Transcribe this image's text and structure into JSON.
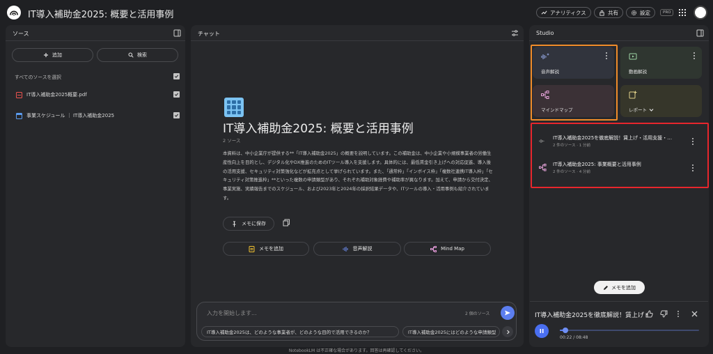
{
  "app": {
    "notebook_title": "IT導入補助金2025: 概要と活用事例",
    "footer": "NotebookLM は不正確な場合があります。回答は再確認してください。"
  },
  "header": {
    "analytics": "アナリティクス",
    "share": "共有",
    "settings": "設定",
    "pro_badge": "PRO"
  },
  "sources": {
    "heading": "ソース",
    "add": "追加",
    "search": "検索",
    "select_all": "すべてのソースを選択",
    "items": [
      {
        "label": "IT導入補助金2025概要.pdf",
        "type": "pdf"
      },
      {
        "label": "事業スケジュール ｜ IT導入補助金2025",
        "type": "web"
      }
    ]
  },
  "chat": {
    "heading": "チャット",
    "title": "IT導入補助金2025: 概要と活用事例",
    "source_count": "2 ソース",
    "summary": "本資料は、中小企業庁が提供する**「IT導入補助金2025」の概要を説明しています。この補助金は、中小企業や小規模事業者の労働生産性向上を目的とし、デジタル化やDX推進のためのITツール導入を支援します。具体的には、最低賃金引き上げへの対応促進、導入後の活用支援、セキュリティ対策強化などが拡充点として挙げられています。また、「通常枠」「インボイス枠」「複数社連携IT導入枠」「セキュリティ対策推進枠」**といった複数の申請類型があり、それぞれ補助対象経費や補助率が異なります。加えて、申請から交付決定、事業実施、実績報告までのスケジュール、および2023年と2024年の採択結果データや、ITツールの導入・活用事例も紹介されています。",
    "save_memo": "メモに保存",
    "add_note": "メモを追加",
    "audio_overview": "音声解説",
    "mind_map": "Mind Map",
    "input_placeholder": "入力を開始します...",
    "input_sources": "2 個のソース",
    "suggestions": [
      "IT導入補助金2025は、どのような事業者が、どのような目的で活用できるのか？",
      "IT導入補助金2025にはどのような申請類型"
    ]
  },
  "studio": {
    "heading": "Studio",
    "cards": [
      {
        "label": "音声解説"
      },
      {
        "label": "動画解説"
      },
      {
        "label": "マインドマップ"
      },
      {
        "label": "レポート"
      }
    ],
    "notes": [
      {
        "title": "IT導入補助金2025を徹底解説！賃上げ・活用支援・…",
        "meta": "2 件のソース · 1 分前"
      },
      {
        "title": "IT導入補助金2025: 事業概要と活用事例",
        "meta": "2 件のソース · 4 分前"
      }
    ],
    "add_note": "メモを追加",
    "player": {
      "title": "IT導入補助金2025を徹底解説！賃上げ・",
      "time": "00:22 / 08:48",
      "progress": 0.042
    }
  },
  "colors": {
    "accent": "#5c7ef0",
    "highlight_orange": "#f08c2a",
    "highlight_red": "#e8262d"
  }
}
